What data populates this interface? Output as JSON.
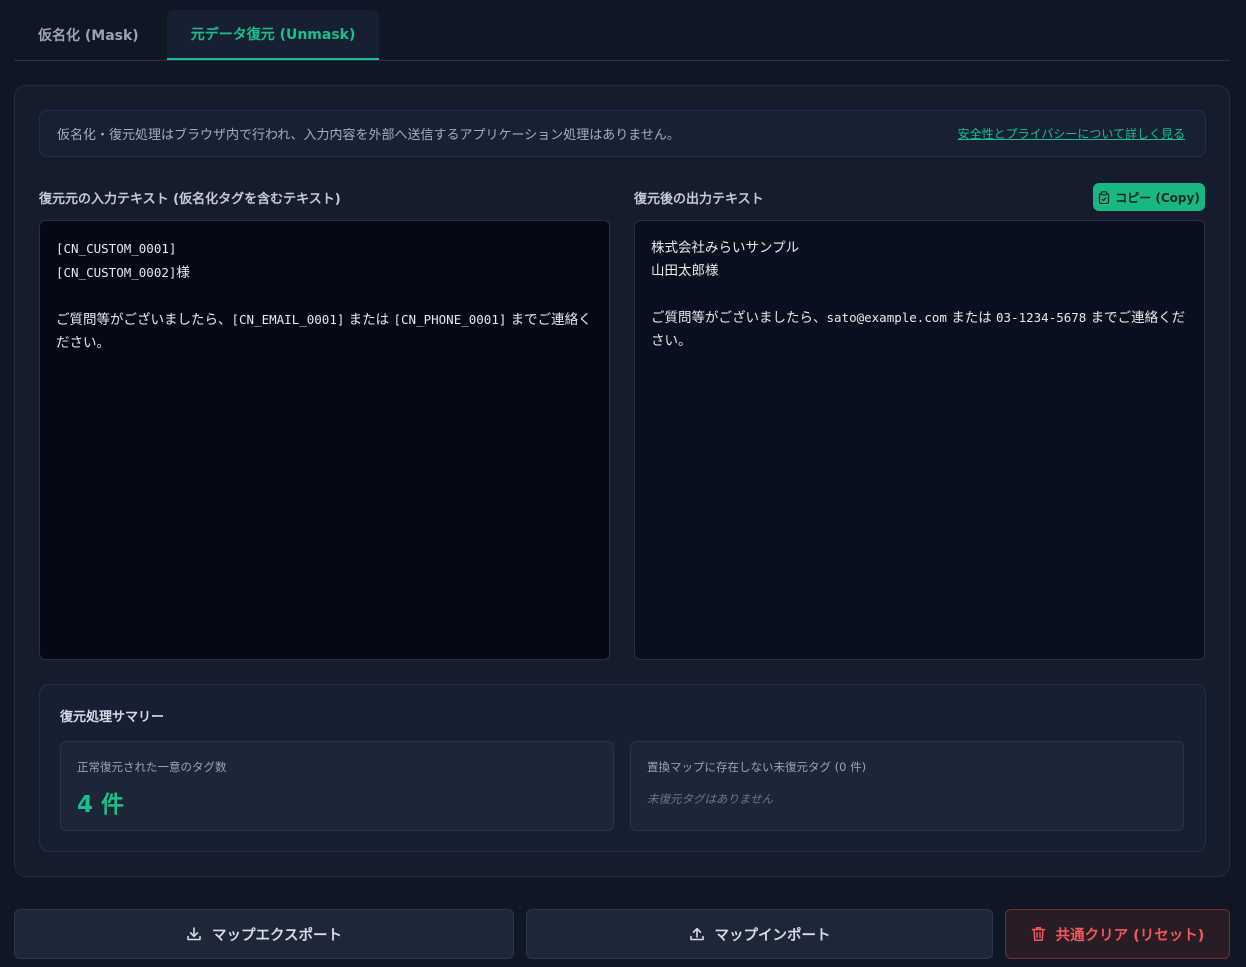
{
  "tabs": [
    {
      "label": "仮名化 (Mask)",
      "active": false
    },
    {
      "label": "元データ復元 (Unmask)",
      "active": true
    }
  ],
  "notice": {
    "text": "仮名化・復元処理はブラウザ内で行われ、入力内容を外部へ送信するアプリケーション処理はありません。",
    "link": "安全性とプライバシーについて詳しく見る"
  },
  "input": {
    "label": "復元元の入力テキスト (仮名化タグを含むテキスト)",
    "lines": {
      "l1": "[CN_CUSTOM_0001]",
      "l2a": "[CN_CUSTOM_0002]",
      "l2b": "様",
      "l4a": "ご質問等がございましたら、",
      "l4b": "[CN_EMAIL_0001]",
      "l4c": " または ",
      "l4d": "[CN_PHONE_0001]",
      "l4e": " までご連絡ください。"
    }
  },
  "output": {
    "label": "復元後の出力テキスト",
    "copy_label": "コピー (Copy)",
    "lines": {
      "l1": "株式会社みらいサンプル",
      "l2": "山田太郎様",
      "l4a": "ご質問等がございましたら、",
      "l4b": "sato@example.com",
      "l4c": " または ",
      "l4d": "03-1234-5678",
      "l4e": " までご連絡ください。"
    }
  },
  "summary": {
    "title": "復元処理サマリー",
    "restored_label": "正常復元された一意のタグ数",
    "restored_value": "4 件",
    "missing_label": "置換マップに存在しない未復元タグ (0 件)",
    "missing_empty": "未復元タグはありません"
  },
  "actions": {
    "export": "マップエクスポート",
    "import": "マップインポート",
    "clear": "共通クリア (リセット)"
  },
  "colors": {
    "accent": "#19c08a",
    "danger": "#ef5a5a",
    "background": "#0f1624"
  }
}
